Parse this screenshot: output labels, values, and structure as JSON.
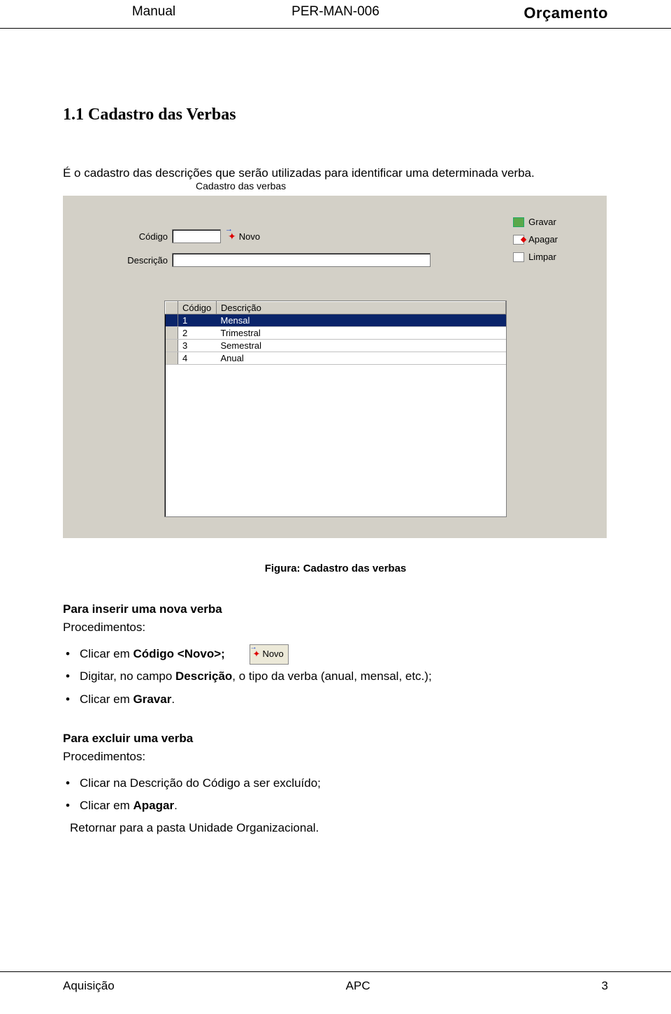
{
  "header": {
    "left": "Manual",
    "mid": "PER-MAN-006",
    "right": "Orçamento"
  },
  "section_title": "1.1 Cadastro das Verbas",
  "intro": "É o cadastro das descrições que serão utilizadas para identificar uma determinada verba.",
  "app": {
    "title": "Cadastro das verbas",
    "labels": {
      "codigo": "Código",
      "descricao": "Descrição",
      "novo": "Novo"
    },
    "side_buttons": {
      "gravar": "Gravar",
      "apagar": "Apagar",
      "limpar": "Limpar"
    },
    "grid": {
      "headers": {
        "codigo": "Código",
        "descricao": "Descrição"
      },
      "rows": [
        {
          "codigo": "1",
          "descricao": "Mensal",
          "selected": true
        },
        {
          "codigo": "2",
          "descricao": "Trimestral"
        },
        {
          "codigo": "3",
          "descricao": "Semestral"
        },
        {
          "codigo": "4",
          "descricao": "Anual"
        }
      ]
    }
  },
  "caption": "Figura: Cadastro das verbas",
  "insert": {
    "title": "Para inserir uma nova verba",
    "proc_label": "Procedimentos:",
    "b1_a": "Clicar em ",
    "b1_b": "Código <Novo>;",
    "b2_a": "Digitar, no campo ",
    "b2_b": "Descrição",
    "b2_c": ", o tipo da verba (anual, mensal, etc.);",
    "b3_a": "Clicar em ",
    "b3_b": "Gravar",
    "b3_c": ".",
    "novo_btn": "Novo"
  },
  "delete": {
    "title": "Para excluir uma verba",
    "proc_label": "Procedimentos:",
    "b1": "Clicar na Descrição do Código a ser excluído;",
    "b2_a": "Clicar em ",
    "b2_b": "Apagar",
    "b2_c": ".",
    "return_a": "Retornar para a pasta Unidade Organizacional."
  },
  "footer": {
    "left": "Aquisição",
    "mid": "APC",
    "right": "3"
  }
}
